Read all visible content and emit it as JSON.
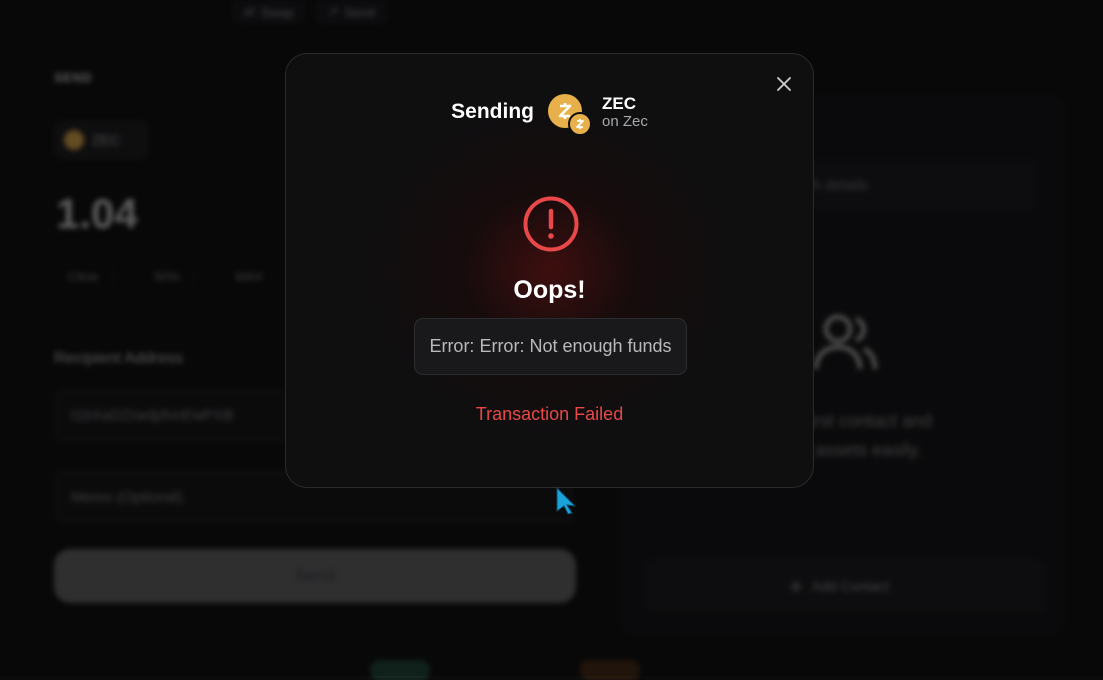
{
  "background": {
    "tabs": [
      {
        "label": "Swap",
        "icon": "swap-icon"
      },
      {
        "label": "Send",
        "icon": "send-icon"
      }
    ],
    "section_label": "SEND",
    "token_chip": "ZEC",
    "amount": "1.04",
    "quick_buttons": [
      "Clear",
      "50%",
      "MAX"
    ],
    "recipient_label": "Recipient Address",
    "recipient_value": "t1bXaDZrwdpfvnEwPXB",
    "memo_placeholder": "Memo (Optional)",
    "send_label": "Send",
    "contacts_search": "ch details",
    "contacts_text_line1": "first contact and",
    "contacts_text_line2": "t assets easily.",
    "add_contact_label": "Add Contact"
  },
  "modal": {
    "sending_label": "Sending",
    "token_symbol": "ZEC",
    "token_network": "on Zec",
    "title": "Oops!",
    "error_message": "Error: Error: Not enough funds",
    "status": "Transaction Failed",
    "colors": {
      "error": "#e94848",
      "coin": "#e8b04a"
    }
  }
}
